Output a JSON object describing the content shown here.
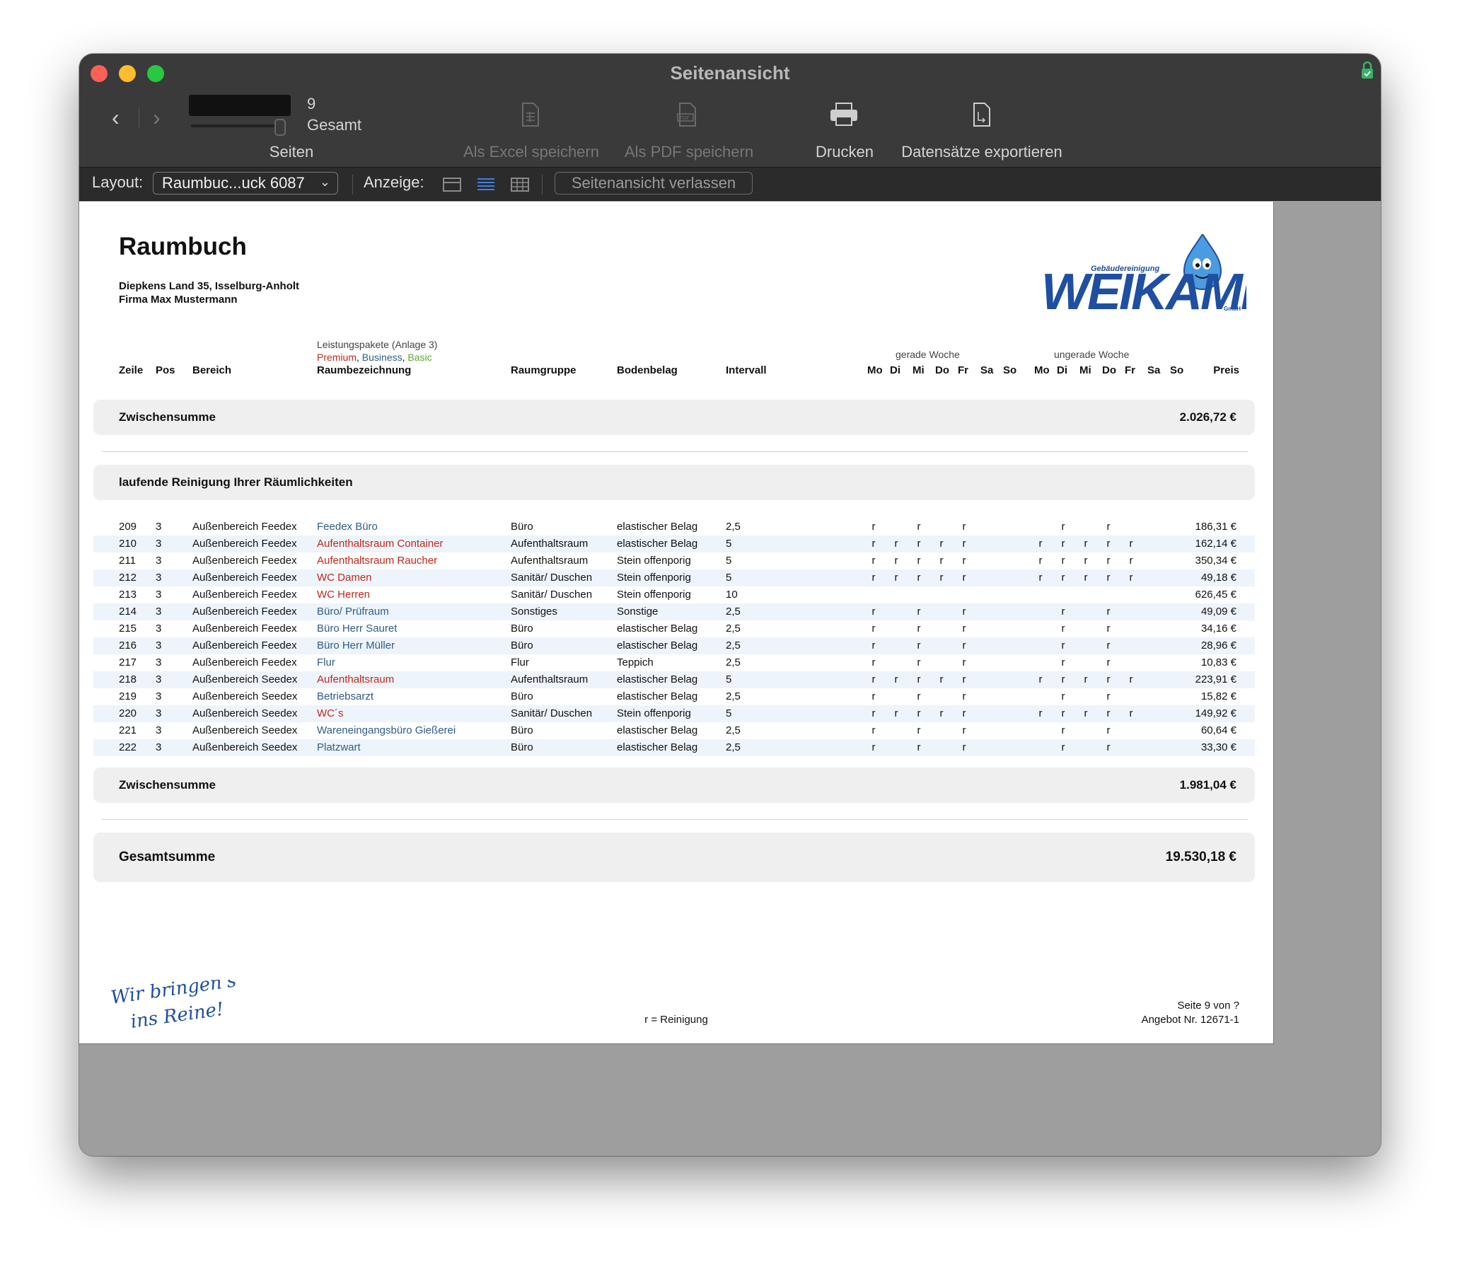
{
  "window": {
    "title": "Seitenansicht"
  },
  "toolbar": {
    "page_number": "9",
    "page_total": "Gesamt",
    "pages_label": "Seiten",
    "excel_label": "Als Excel speichern",
    "pdf_label": "Als PDF speichern",
    "print_label": "Drucken",
    "export_label": "Datensätze exportieren"
  },
  "layoutbar": {
    "layout_label": "Layout:",
    "layout_value": "Raumbuc...uck 6087",
    "display_label": "Anzeige:",
    "exit_label": "Seitenansicht verlassen"
  },
  "report": {
    "title": "Raumbuch",
    "address": "Diepkens Land 35, Isselburg-Anholt",
    "company": "Firma Max Mustermann",
    "logo_text": "WEIKAMP",
    "logo_sub": "Gebäudereinigung",
    "logo_gmbh": "GmbH",
    "headers": {
      "pkg_title": "Leistungspakete (Anlage 3)",
      "pkg_premium": "Premium",
      "pkg_comma1": ", ",
      "pkg_business": "Business",
      "pkg_comma2": ", ",
      "pkg_basic": "Basic",
      "zeile": "Zeile",
      "pos": "Pos",
      "bereich": "Bereich",
      "raumbezeichnung": "Raumbezeichnung",
      "raumgruppe": "Raumgruppe",
      "bodenbelag": "Bodenbelag",
      "intervall": "Intervall",
      "even_week": "gerade Woche",
      "odd_week": "ungerade Woche",
      "days": [
        "Mo",
        "Di",
        "Mi",
        "Do",
        "Fr",
        "Sa",
        "So"
      ],
      "preis": "Preis"
    },
    "subtotal1": {
      "label": "Zwischensumme",
      "value": "2.026,72 €"
    },
    "section_title": "laufende Reinigung Ihrer Räumlichkeiten",
    "rows": [
      {
        "zeile": "209",
        "pos": "3",
        "bereich": "Außenbereich Feedex",
        "raum": "Feedex Büro",
        "pkg": "business",
        "gruppe": "Büro",
        "boden": "elastischer Belag",
        "intervall": "2,5",
        "even": [
          "r",
          "",
          "r",
          "",
          "r",
          "",
          ""
        ],
        "odd": [
          "",
          "r",
          "",
          "r",
          "",
          "",
          ""
        ],
        "preis": "186,31 €"
      },
      {
        "zeile": "210",
        "pos": "3",
        "bereich": "Außenbereich Feedex",
        "raum": "Aufenthaltsraum Container",
        "pkg": "premium",
        "gruppe": "Aufenthaltsraum",
        "boden": "elastischer Belag",
        "intervall": "5",
        "even": [
          "r",
          "r",
          "r",
          "r",
          "r",
          "",
          ""
        ],
        "odd": [
          "r",
          "r",
          "r",
          "r",
          "r",
          "",
          ""
        ],
        "preis": "162,14 €"
      },
      {
        "zeile": "211",
        "pos": "3",
        "bereich": "Außenbereich Feedex",
        "raum": "Aufenthaltsraum Raucher",
        "pkg": "premium",
        "gruppe": "Aufenthaltsraum",
        "boden": "Stein offenporig",
        "intervall": "5",
        "even": [
          "r",
          "r",
          "r",
          "r",
          "r",
          "",
          ""
        ],
        "odd": [
          "r",
          "r",
          "r",
          "r",
          "r",
          "",
          ""
        ],
        "preis": "350,34 €"
      },
      {
        "zeile": "212",
        "pos": "3",
        "bereich": "Außenbereich Feedex",
        "raum": "WC Damen",
        "pkg": "premium",
        "gruppe": "Sanitär/ Duschen",
        "boden": "Stein offenporig",
        "intervall": "5",
        "even": [
          "r",
          "r",
          "r",
          "r",
          "r",
          "",
          ""
        ],
        "odd": [
          "r",
          "r",
          "r",
          "r",
          "r",
          "",
          ""
        ],
        "preis": "49,18 €"
      },
      {
        "zeile": "213",
        "pos": "3",
        "bereich": "Außenbereich Feedex",
        "raum": "WC Herren",
        "pkg": "premium",
        "gruppe": "Sanitär/ Duschen",
        "boden": "Stein offenporig",
        "intervall": "10",
        "even": [
          "",
          "",
          "",
          "",
          "",
          "",
          ""
        ],
        "odd": [
          "",
          "",
          "",
          "",
          "",
          "",
          ""
        ],
        "preis": "626,45 €"
      },
      {
        "zeile": "214",
        "pos": "3",
        "bereich": "Außenbereich Feedex",
        "raum": "Büro/ Prüfraum",
        "pkg": "business",
        "gruppe": "Sonstiges",
        "boden": "Sonstige",
        "intervall": "2,5",
        "even": [
          "r",
          "",
          "r",
          "",
          "r",
          "",
          ""
        ],
        "odd": [
          "",
          "r",
          "",
          "r",
          "",
          "",
          ""
        ],
        "preis": "49,09 €"
      },
      {
        "zeile": "215",
        "pos": "3",
        "bereich": "Außenbereich Feedex",
        "raum": "Büro Herr Sauret",
        "pkg": "business",
        "gruppe": "Büro",
        "boden": "elastischer Belag",
        "intervall": "2,5",
        "even": [
          "r",
          "",
          "r",
          "",
          "r",
          "",
          ""
        ],
        "odd": [
          "",
          "r",
          "",
          "r",
          "",
          "",
          ""
        ],
        "preis": "34,16 €"
      },
      {
        "zeile": "216",
        "pos": "3",
        "bereich": "Außenbereich Feedex",
        "raum": "Büro Herr Müller",
        "pkg": "business",
        "gruppe": "Büro",
        "boden": "elastischer Belag",
        "intervall": "2,5",
        "even": [
          "r",
          "",
          "r",
          "",
          "r",
          "",
          ""
        ],
        "odd": [
          "",
          "r",
          "",
          "r",
          "",
          "",
          ""
        ],
        "preis": "28,96 €"
      },
      {
        "zeile": "217",
        "pos": "3",
        "bereich": "Außenbereich Feedex",
        "raum": "Flur",
        "pkg": "business",
        "gruppe": "Flur",
        "boden": "Teppich",
        "intervall": "2,5",
        "even": [
          "r",
          "",
          "r",
          "",
          "r",
          "",
          ""
        ],
        "odd": [
          "",
          "r",
          "",
          "r",
          "",
          "",
          ""
        ],
        "preis": "10,83 €"
      },
      {
        "zeile": "218",
        "pos": "3",
        "bereich": "Außenbereich Seedex",
        "raum": "Aufenthaltsraum",
        "pkg": "premium",
        "gruppe": "Aufenthaltsraum",
        "boden": "elastischer Belag",
        "intervall": "5",
        "even": [
          "r",
          "r",
          "r",
          "r",
          "r",
          "",
          ""
        ],
        "odd": [
          "r",
          "r",
          "r",
          "r",
          "r",
          "",
          ""
        ],
        "preis": "223,91 €"
      },
      {
        "zeile": "219",
        "pos": "3",
        "bereich": "Außenbereich Seedex",
        "raum": "Betriebsarzt",
        "pkg": "business",
        "gruppe": "Büro",
        "boden": "elastischer Belag",
        "intervall": "2,5",
        "even": [
          "r",
          "",
          "r",
          "",
          "r",
          "",
          ""
        ],
        "odd": [
          "",
          "r",
          "",
          "r",
          "",
          "",
          ""
        ],
        "preis": "15,82 €"
      },
      {
        "zeile": "220",
        "pos": "3",
        "bereich": "Außenbereich Seedex",
        "raum": "WC´s",
        "pkg": "premium",
        "gruppe": "Sanitär/ Duschen",
        "boden": "Stein offenporig",
        "intervall": "5",
        "even": [
          "r",
          "r",
          "r",
          "r",
          "r",
          "",
          ""
        ],
        "odd": [
          "r",
          "r",
          "r",
          "r",
          "r",
          "",
          ""
        ],
        "preis": "149,92 €"
      },
      {
        "zeile": "221",
        "pos": "3",
        "bereich": "Außenbereich Seedex",
        "raum": "Wareneingangsbüro Gießerei",
        "pkg": "business",
        "gruppe": "Büro",
        "boden": "elastischer Belag",
        "intervall": "2,5",
        "even": [
          "r",
          "",
          "r",
          "",
          "r",
          "",
          ""
        ],
        "odd": [
          "",
          "r",
          "",
          "r",
          "",
          "",
          ""
        ],
        "preis": "60,64 €"
      },
      {
        "zeile": "222",
        "pos": "3",
        "bereich": "Außenbereich Seedex",
        "raum": "Platzwart",
        "pkg": "business",
        "gruppe": "Büro",
        "boden": "elastischer Belag",
        "intervall": "2,5",
        "even": [
          "r",
          "",
          "r",
          "",
          "r",
          "",
          ""
        ],
        "odd": [
          "",
          "r",
          "",
          "r",
          "",
          "",
          ""
        ],
        "preis": "33,30 €"
      }
    ],
    "subtotal2": {
      "label": "Zwischensumme",
      "value": "1.981,04 €"
    },
    "total": {
      "label": "Gesamtsumme",
      "value": "19.530,18 €"
    },
    "footer": {
      "slogan_line1": "Wir bringen's",
      "slogan_line2": "ins Reine!",
      "legend": "r = Reinigung",
      "page": "Seite 9 von ?",
      "offer": "Angebot Nr. 12671-1"
    },
    "colors": {
      "premium": "#c0281b",
      "business": "#2e5c8a",
      "basic": "#5da82f",
      "slogan": "#1f4f9c",
      "logo": "#1f4fa0"
    }
  }
}
